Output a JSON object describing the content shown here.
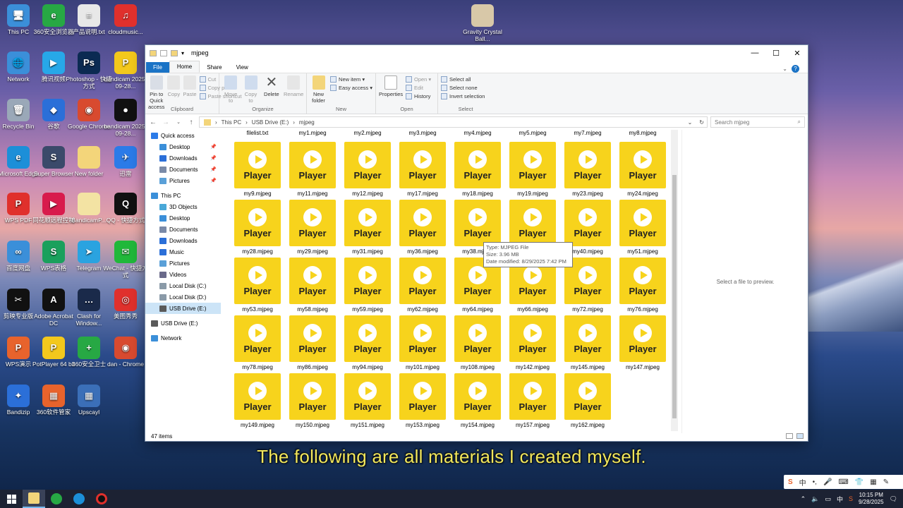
{
  "desktop": {
    "icons": [
      {
        "label": "This PC",
        "color": "#3b8fd9",
        "glyph": "🖥"
      },
      {
        "label": "360安全浏览器",
        "color": "#27a844",
        "glyph": "e"
      },
      {
        "label": "产品说明.txt",
        "color": "#e8e8e8",
        "glyph": "≡"
      },
      {
        "label": "cloudmusic...",
        "color": "#e0302c",
        "glyph": "♫"
      },
      {
        "label": "Network",
        "color": "#3b8fd9",
        "glyph": "🌐"
      },
      {
        "label": "腾讯视频",
        "color": "#27a8e8",
        "glyph": "▶"
      },
      {
        "label": "Photoshop - 快捷方式",
        "color": "#0b2a52",
        "glyph": "Ps"
      },
      {
        "label": "bandicam 2025-09-28...",
        "color": "#f3c81c",
        "glyph": "P"
      },
      {
        "label": "Recycle Bin",
        "color": "#9aa8b8",
        "glyph": "🗑"
      },
      {
        "label": "谷歌",
        "color": "#2b6fd8",
        "glyph": "◆"
      },
      {
        "label": "Google Chrome",
        "color": "#d84a2f",
        "glyph": "◉"
      },
      {
        "label": "bandicam 2025-09-28...",
        "color": "#111111",
        "glyph": "●"
      },
      {
        "label": "Microsoft Edge",
        "color": "#1c8fd8",
        "glyph": "e"
      },
      {
        "label": "Super Browser",
        "color": "#3b4a6a",
        "glyph": "S"
      },
      {
        "label": "New folder",
        "color": "#f3d57a",
        "glyph": ""
      },
      {
        "label": "迅雷",
        "color": "#2b7be8",
        "glyph": "✈"
      },
      {
        "label": "WPS PDF",
        "color": "#e0302c",
        "glyph": "P"
      },
      {
        "label": "同花顺远程控制",
        "color": "#d81b4c",
        "glyph": "▶"
      },
      {
        "label": "BandicamP...",
        "color": "#f3e3a3",
        "glyph": ""
      },
      {
        "label": "QQ - 快捷方式",
        "color": "#111111",
        "glyph": "Q"
      },
      {
        "label": "百度网盘",
        "color": "#3b8fd9",
        "glyph": "∞"
      },
      {
        "label": "WPS表格",
        "color": "#1aa05c",
        "glyph": "S"
      },
      {
        "label": "Telegram",
        "color": "#2aa3e0",
        "glyph": "➤"
      },
      {
        "label": "WeChat - 快捷方式",
        "color": "#20b83a",
        "glyph": "✉"
      },
      {
        "label": "剪映专业版",
        "color": "#111111",
        "glyph": "✂"
      },
      {
        "label": "Adobe Acrobat DC",
        "color": "#111111",
        "glyph": "A"
      },
      {
        "label": "Clash for Window...",
        "color": "#1a2a4a",
        "glyph": "…"
      },
      {
        "label": "美图秀秀",
        "color": "#e0302c",
        "glyph": "◎"
      },
      {
        "label": "WPS演示",
        "color": "#e8632c",
        "glyph": "P"
      },
      {
        "label": "PotPlayer 64 bit",
        "color": "#f3c81c",
        "glyph": "P"
      },
      {
        "label": "360安全卫士",
        "color": "#27a844",
        "glyph": "+"
      },
      {
        "label": "dan - Chrome",
        "color": "#d84a2f",
        "glyph": "◉"
      },
      {
        "label": "Bandizip",
        "color": "#2b6fd8",
        "glyph": "✦"
      },
      {
        "label": "360软件管家",
        "color": "#e8632c",
        "glyph": "▦"
      },
      {
        "label": "Upscayl",
        "color": "#3b6fb8",
        "glyph": "▦"
      },
      {
        "label": "Gravity Crystal Ball...",
        "color": "#d8c8a8",
        "glyph": ""
      }
    ]
  },
  "explorer": {
    "title": "mjpeg",
    "tabs": [
      "File",
      "Home",
      "Share",
      "View"
    ],
    "ribbon": {
      "clipboard": {
        "name": "Clipboard",
        "pin": "Pin to Quick access",
        "copy": "Copy",
        "paste": "Paste",
        "cut": "Cut",
        "copy_path": "Copy path",
        "paste_shortcut": "Paste shortcut"
      },
      "organize": {
        "name": "Organize",
        "move": "Move to",
        "copy": "Copy to",
        "delete": "Delete",
        "rename": "Rename"
      },
      "new": {
        "name": "New",
        "new_folder": "New folder",
        "new_item": "New item ▾",
        "easy_access": "Easy access ▾"
      },
      "open": {
        "name": "Open",
        "properties": "Properties",
        "open": "Open ▾",
        "edit": "Edit",
        "history": "History"
      },
      "select": {
        "name": "Select",
        "select_all": "Select all",
        "select_none": "Select none",
        "invert": "Invert selection"
      }
    },
    "address": {
      "path": [
        "This PC",
        "USB Drive (E:)",
        "mjpeg"
      ],
      "search_placeholder": "Search mjpeg"
    },
    "nav": [
      {
        "label": "Quick access",
        "top": true,
        "color": "#2b7be8"
      },
      {
        "label": "Desktop",
        "pin": true,
        "color": "#3b8fd9"
      },
      {
        "label": "Downloads",
        "pin": true,
        "color": "#2b6fd8"
      },
      {
        "label": "Documents",
        "pin": true,
        "color": "#7a8aa8"
      },
      {
        "label": "Pictures",
        "pin": true,
        "color": "#5aa0d8"
      },
      {
        "label": "This PC",
        "top": true,
        "color": "#3b8fd9",
        "gap": true
      },
      {
        "label": "3D Objects",
        "color": "#4aa8d8"
      },
      {
        "label": "Desktop",
        "color": "#3b8fd9"
      },
      {
        "label": "Documents",
        "color": "#7a8aa8"
      },
      {
        "label": "Downloads",
        "color": "#2b6fd8"
      },
      {
        "label": "Music",
        "color": "#2b6fd8"
      },
      {
        "label": "Pictures",
        "color": "#5aa0d8"
      },
      {
        "label": "Videos",
        "color": "#6a6a8a"
      },
      {
        "label": "Local Disk (C:)",
        "color": "#8a9aa8"
      },
      {
        "label": "Local Disk (D:)",
        "color": "#8a9aa8"
      },
      {
        "label": "USB Drive (E:)",
        "color": "#5a5a5a",
        "selected": true
      },
      {
        "label": "USB Drive (E:)",
        "top": true,
        "color": "#5a5a5a",
        "gap": true
      },
      {
        "label": "Network",
        "top": true,
        "color": "#3b8fd9",
        "gap": true
      }
    ],
    "first_row": [
      "filelist.txt",
      "my1.mjpeg",
      "my2.mjpeg",
      "my3.mjpeg",
      "my4.mjpeg",
      "my5.mjpeg",
      "my7.mjpeg",
      "my8.mjpeg"
    ],
    "thumb_label": "Player",
    "files": [
      "my9.mjpeg",
      "my11.mjpeg",
      "my12.mjpeg",
      "my17.mjpeg",
      "my18.mjpeg",
      "my19.mjpeg",
      "my23.mjpeg",
      "my24.mjpeg",
      "my28.mjpeg",
      "my29.mjpeg",
      "my31.mjpeg",
      "my36.mjpeg",
      "my38.mjpeg",
      "",
      "my40.mjpeg",
      "my51.mjpeg",
      "my53.mjpeg",
      "my58.mjpeg",
      "my59.mjpeg",
      "my62.mjpeg",
      "my64.mjpeg",
      "my66.mjpeg",
      "my72.mjpeg",
      "my76.mjpeg",
      "my78.mjpeg",
      "my86.mjpeg",
      "my94.mjpeg",
      "my101.mjpeg",
      "my108.mjpeg",
      "my142.mjpeg",
      "my145.mjpeg",
      "my147.mjpeg",
      "my149.mjpeg",
      "my150.mjpeg",
      "my151.mjpeg",
      "my153.mjpeg",
      "my154.mjpeg",
      "my157.mjpeg",
      "my162.mjpeg"
    ],
    "tooltip": {
      "type": "Type: MJPEG File",
      "size": "Size: 3.96 MB",
      "date": "Date modified: 8/29/2025 7:42 PM"
    },
    "preview_text": "Select a file to preview.",
    "status": "47 items"
  },
  "subtitle": "The following are all materials I created myself.",
  "taskbar": {
    "time": "10:15 PM",
    "date": "9/28/2025",
    "ime": "中"
  }
}
